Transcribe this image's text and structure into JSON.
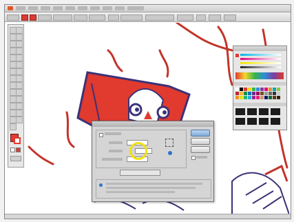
{
  "window": {
    "menu_items": 14
  },
  "colors": {
    "accent_red": "#e13a2f",
    "outline": "#3b3277",
    "highlight": "#f1e10f"
  },
  "icons": [
    "selection-tool-icon",
    "direct-selection-tool-icon",
    "magic-wand-icon",
    "lasso-icon",
    "pen-icon",
    "type-icon",
    "line-icon",
    "rectangle-icon",
    "paintbrush-icon",
    "pencil-icon",
    "blob-brush-icon",
    "eraser-icon",
    "rotate-icon",
    "scale-icon",
    "warp-icon",
    "free-transform-icon",
    "symbol-sprayer-icon",
    "graph-icon",
    "mesh-icon",
    "gradient-icon",
    "eyedropper-icon",
    "blend-icon",
    "live-paint-icon",
    "live-paint-selection-icon",
    "crop-icon",
    "slice-icon",
    "scissors-icon",
    "hand-icon",
    "zoom-icon"
  ],
  "dialog": {
    "ok_label": "",
    "cancel_label": "",
    "copy_label": "",
    "preview_label": "",
    "field_value": ""
  }
}
